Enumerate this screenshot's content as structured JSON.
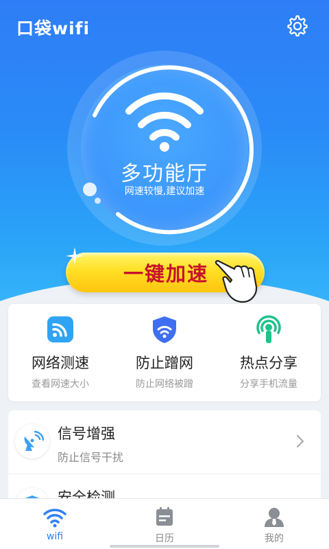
{
  "app": {
    "title": "口袋wifi"
  },
  "header": {
    "settings_icon": "gear-icon"
  },
  "hero": {
    "title": "多功能厅",
    "subtitle": "网速较慢,建议加速",
    "boost_label": "一键加速",
    "wifi_icon": "wifi-icon"
  },
  "tools": [
    {
      "title": "网络测速",
      "subtitle": "查看网速大小",
      "icon": "speed-test-icon",
      "color": "#2fa3f4"
    },
    {
      "title": "防止蹭网",
      "subtitle": "防止网络被蹭",
      "icon": "shield-wifi-icon",
      "color": "#3f6ff0"
    },
    {
      "title": "热点分享",
      "subtitle": "分享手机流量",
      "icon": "hotspot-icon",
      "color": "#1fc28a"
    }
  ],
  "list": [
    {
      "title": "信号增强",
      "subtitle": "防止信号干扰",
      "icon": "signal-dish-icon"
    },
    {
      "title": "安全检测",
      "subtitle": "",
      "icon": "security-check-icon"
    }
  ],
  "tabs": [
    {
      "label": "wifi",
      "icon": "wifi-icon",
      "active": true
    },
    {
      "label": "日历",
      "icon": "calendar-icon",
      "active": false
    },
    {
      "label": "我的",
      "icon": "user-icon",
      "active": false
    }
  ],
  "colors": {
    "accent": "#2f80f6",
    "boost_text": "#c8102e",
    "boost_button": "#ffd21f"
  }
}
